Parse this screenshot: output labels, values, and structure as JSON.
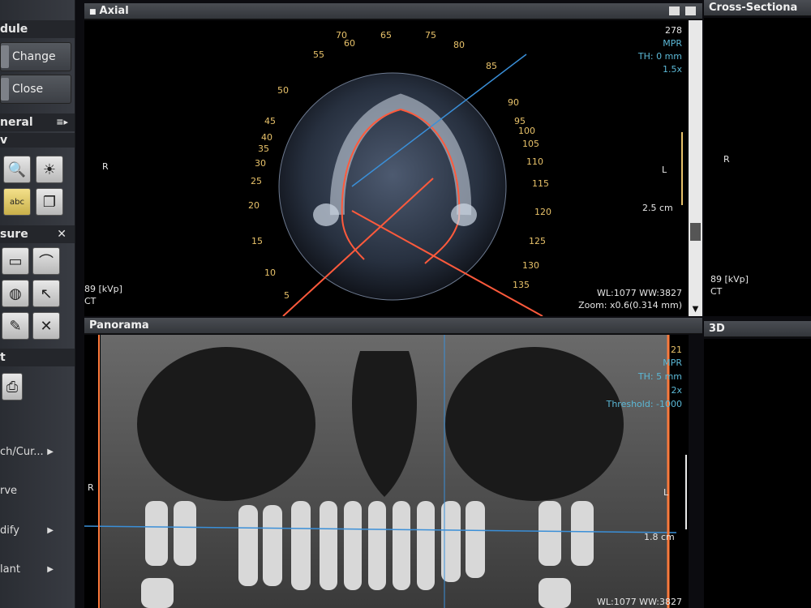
{
  "sidebar": {
    "module_header": "dule",
    "change_label": "Change",
    "close_label": "Close",
    "general_header": "neral",
    "view_header": "v",
    "measure_header": "sure",
    "print_header": "t",
    "menu": [
      {
        "label": "ch/Cur..."
      },
      {
        "label": "rve"
      },
      {
        "label": "dify"
      },
      {
        "label": "lant"
      }
    ],
    "abc_label": "abc"
  },
  "axial": {
    "title": "Axial",
    "ov_slice": "278",
    "ov_mode": "MPR",
    "ov_th": "TH: 0 mm",
    "ov_zoomf": "1.5x",
    "ov_r": "R",
    "ov_l": "L",
    "ov_scale": "2.5 cm",
    "ov_kvp": "89 [kVp]",
    "ov_ct": "CT",
    "ov_wl": "WL:1077 WW:3827",
    "ov_zoom": "Zoom: x0.6(0.314 mm)",
    "angles": [
      "5",
      "10",
      "15",
      "20",
      "25",
      "30",
      "35",
      "40",
      "45",
      "50",
      "55",
      "60",
      "65",
      "70",
      "75",
      "80",
      "85",
      "90",
      "95",
      "100",
      "105",
      "110",
      "115",
      "120",
      "125",
      "130",
      "135"
    ]
  },
  "cross": {
    "title": "Cross-Sectiona",
    "ov_r": "R",
    "ov_kvp": "89 [kVp]",
    "ov_ct": "CT"
  },
  "panorama": {
    "title": "Panorama",
    "ov_slice": "21",
    "ov_mode": "MPR",
    "ov_th": "TH: 5 mm",
    "ov_zoomf": "2x",
    "ov_threshold": "Threshold: -1000",
    "ov_r": "R",
    "ov_l": "L",
    "ov_scale": "1.8 cm",
    "ov_wl": "WL:1077 WW:3827"
  },
  "three_d": {
    "title": "3D"
  },
  "colors": {
    "orange": "#e8c26a",
    "cyan": "#5bb8d6",
    "line_red": "#ff5a3c",
    "line_blue": "#3a8fd8"
  }
}
